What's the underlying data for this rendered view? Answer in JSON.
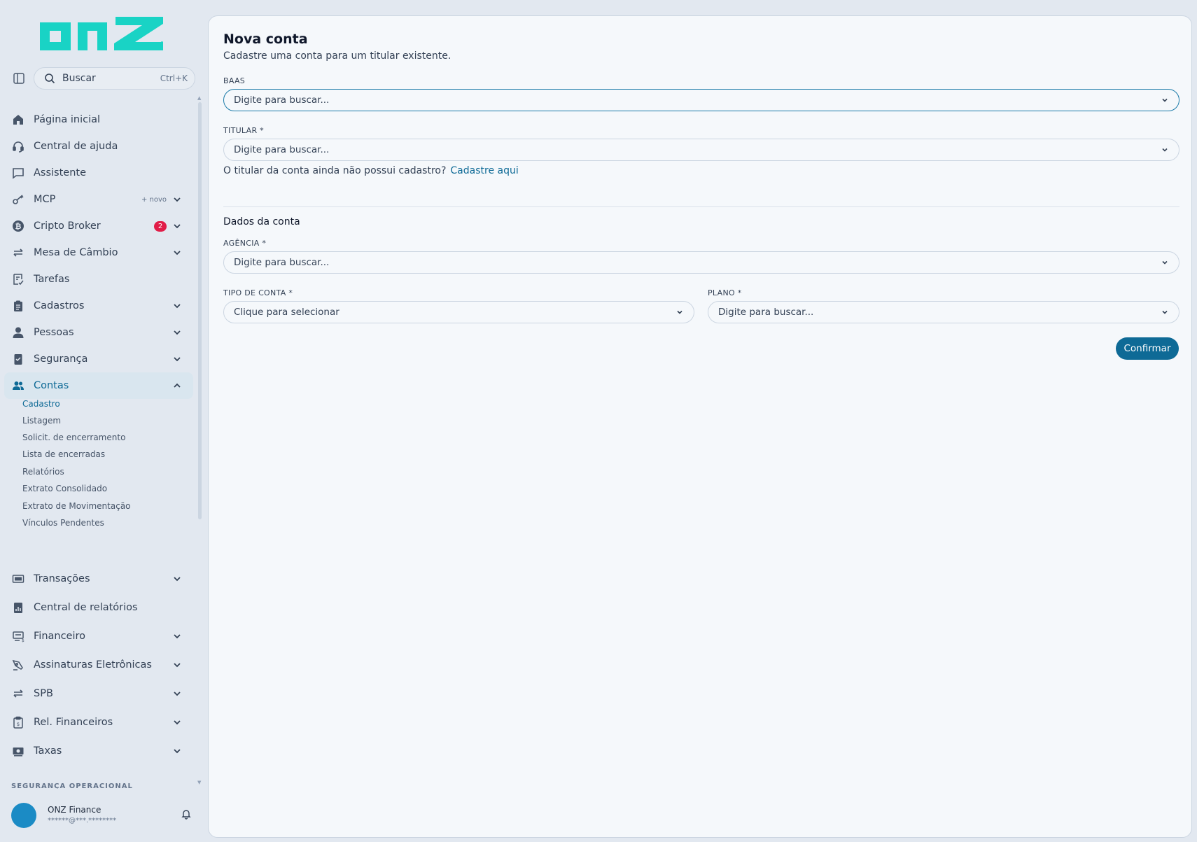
{
  "brand": {
    "logo_text": "onz",
    "accent": "#19d3c5",
    "primary": "#0e6a96"
  },
  "search": {
    "label": "Buscar",
    "shortcut": "Ctrl+K"
  },
  "nav": {
    "items": [
      {
        "label": "Página inicial",
        "icon": "home-icon"
      },
      {
        "label": "Central de ajuda",
        "icon": "headset-icon"
      },
      {
        "label": "Assistente",
        "icon": "chat-icon"
      },
      {
        "label": "MCP",
        "icon": "key-icon",
        "tag": "+ novo"
      },
      {
        "label": "Cripto Broker",
        "icon": "bitcoin-icon",
        "badge": "2"
      },
      {
        "label": "Mesa de Câmbio",
        "icon": "exchange-icon"
      },
      {
        "label": "Tarefas",
        "icon": "task-icon"
      },
      {
        "label": "Cadastros",
        "icon": "clipboard-icon"
      },
      {
        "label": "Pessoas",
        "icon": "person-icon"
      },
      {
        "label": "Segurança",
        "icon": "shield-check-icon"
      },
      {
        "label": "Contas",
        "icon": "users-icon"
      },
      {
        "label": "Transações",
        "icon": "cash-icon"
      },
      {
        "label": "Central de relatórios",
        "icon": "report-icon"
      },
      {
        "label": "Financeiro",
        "icon": "finance-icon"
      },
      {
        "label": "Assinaturas Eletrônicas",
        "icon": "signature-icon"
      },
      {
        "label": "SPB",
        "icon": "exchange-icon"
      },
      {
        "label": "Rel. Financeiros",
        "icon": "clipboard-money-icon"
      },
      {
        "label": "Taxas",
        "icon": "money-icon"
      }
    ],
    "contas_sub": [
      "Cadastro",
      "Listagem",
      "Solicit. de encerramento",
      "Lista de encerradas",
      "Relatórios",
      "Extrato Consolidado",
      "Extrato de Movimentação",
      "Vínculos Pendentes"
    ],
    "section_label": "SEGURANÇA OPERACIONAL"
  },
  "user": {
    "name": "ONZ Finance",
    "email": "******@***.********"
  },
  "form": {
    "title": "Nova conta",
    "subtitle": "Cadastre uma conta para um titular existente.",
    "baas_label": "BAAS",
    "baas_placeholder": "Digite para buscar...",
    "titular_label": "TITULAR  *",
    "titular_placeholder": "Digite para buscar...",
    "hint_text": "O titular da conta ainda não possui cadastro?",
    "hint_link": "Cadastre aqui",
    "section_title": "Dados da conta",
    "agencia_label": "AGÊNCIA  *",
    "agencia_placeholder": "Digite para buscar...",
    "tipo_label": "TIPO DE CONTA  *",
    "tipo_placeholder": "Clique para selecionar",
    "plano_label": "PLANO  *",
    "plano_placeholder": "Digite para buscar...",
    "confirm_label": "Confirmar"
  }
}
